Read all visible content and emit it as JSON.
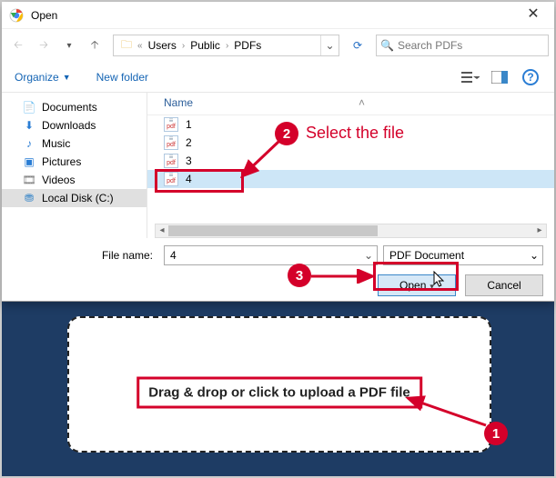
{
  "title": "Open",
  "breadcrumb": {
    "root_sep": "«",
    "items": [
      "Users",
      "Public",
      "PDFs"
    ]
  },
  "search": {
    "placeholder": "Search PDFs"
  },
  "toolbar": {
    "organize": "Organize",
    "newfolder": "New folder"
  },
  "tree": {
    "items": [
      {
        "label": "Documents",
        "icon": "📄"
      },
      {
        "label": "Downloads",
        "icon": "⬇"
      },
      {
        "label": "Music",
        "icon": "♪"
      },
      {
        "label": "Pictures",
        "icon": "▣"
      },
      {
        "label": "Videos",
        "icon": "🎞"
      },
      {
        "label": "Local Disk (C:)",
        "icon": "⛃"
      }
    ],
    "selected_index": 5
  },
  "list": {
    "header": {
      "name": "Name"
    },
    "files": [
      {
        "label": "1"
      },
      {
        "label": "2"
      },
      {
        "label": "3"
      },
      {
        "label": "4"
      }
    ],
    "selected_index": 3
  },
  "bottom": {
    "filename_label": "File name:",
    "filename_value": "4",
    "filter_value": "PDF Document",
    "open_label": "Open",
    "cancel_label": "Cancel"
  },
  "annotations": {
    "s1": "1",
    "s2": "2",
    "s3": "3",
    "s2_text": "Select the file"
  },
  "drop": {
    "message": "Drag & drop or click to upload a PDF file"
  }
}
